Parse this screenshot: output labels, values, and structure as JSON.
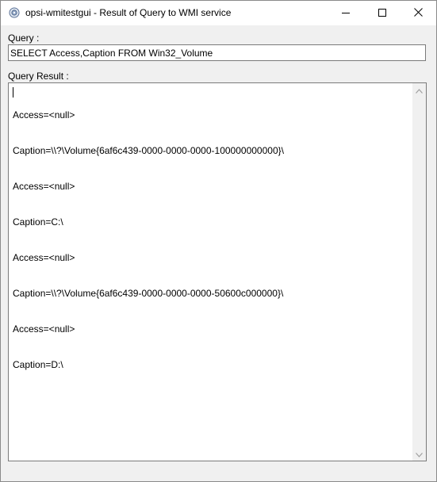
{
  "window": {
    "title": "opsi-wmitestgui - Result of Query to WMI service",
    "app_icon": "opsi-app-icon",
    "controls": {
      "minimize_icon": "minimize-icon",
      "maximize_icon": "maximize-icon",
      "close_icon": "close-icon"
    }
  },
  "query": {
    "label": "Query :",
    "value": "SELECT Access,Caption FROM Win32_Volume"
  },
  "result": {
    "label": "Query Result :",
    "lines": [
      "Access=<null>",
      "Caption=\\\\?\\Volume{6af6c439-0000-0000-0000-100000000000}\\",
      "Access=<null>",
      "Caption=C:\\",
      "Access=<null>",
      "Caption=\\\\?\\Volume{6af6c439-0000-0000-0000-50600c000000}\\",
      "Access=<null>",
      "Caption=D:\\"
    ]
  },
  "colors": {
    "window_bg": "#f0f0f0",
    "titlebar_bg": "#ffffff",
    "border": "#7a7a7a"
  }
}
